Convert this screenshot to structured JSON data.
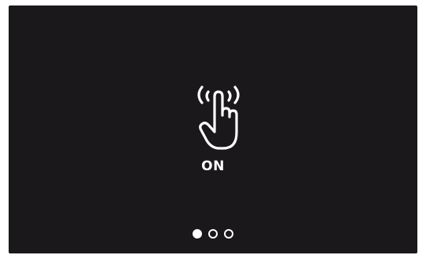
{
  "screen": {
    "status_label": "ON",
    "icon": "tap-gesture-icon",
    "background_color": "#1b181b",
    "foreground_color": "#ffffff"
  },
  "pager": {
    "page_count": 3,
    "current_page": 1
  }
}
